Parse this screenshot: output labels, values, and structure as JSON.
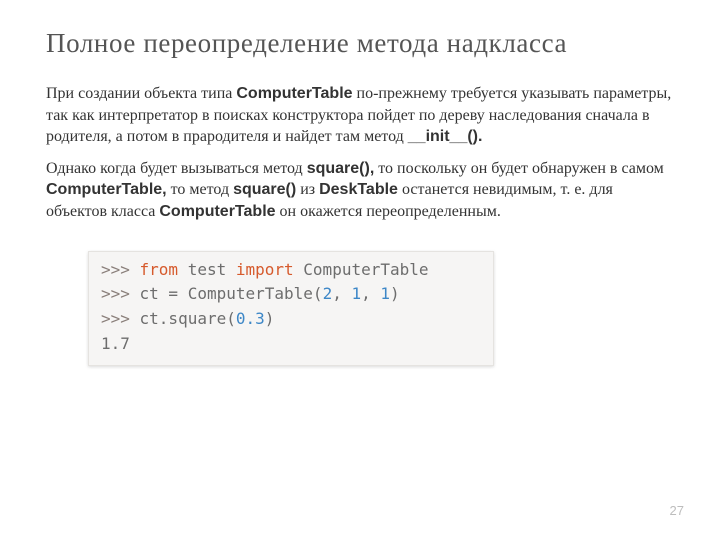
{
  "title": "Полное переопределение метода надкласса",
  "para1_a": "При создании объекта типа ",
  "para1_b": "ComputerTable",
  "para1_c": " по-прежнему требуется указывать параметры, так как интерпретатор в поисках конструктора пойдет по дереву наследования сначала в родителя, а потом в прародителя и найдет там метод ",
  "para1_d": "__init__().",
  "para2_a": "Однако когда будет вызываться метод ",
  "para2_b": "square(),",
  "para2_c": " то поскольку он будет обнаружен в самом ",
  "para2_d": "ComputerTable,",
  "para2_e": " то метод ",
  "para2_f": "square()",
  "para2_g": " из ",
  "para2_h": "DeskTable",
  "para2_i": " останется невидимым, т. е. для объектов класса ",
  "para2_j": "ComputerTable",
  "para2_k": " он окажется переопределенным.",
  "code": {
    "prompt": ">>> ",
    "l1_from": "from",
    "l1_mod": " test ",
    "l1_import": "import",
    "l1_cls": " ComputerTable",
    "l2_assign": "ct = ComputerTable",
    "l2_args_open": "(",
    "l2_n1": "2",
    "l2_c1": ", ",
    "l2_n2": "1",
    "l2_c2": ", ",
    "l2_n3": "1",
    "l2_args_close": ")",
    "l3_call": "ct.square",
    "l3_open": "(",
    "l3_arg": "0.3",
    "l3_close": ")",
    "l4_result": "1.7"
  },
  "pagenum": "27"
}
